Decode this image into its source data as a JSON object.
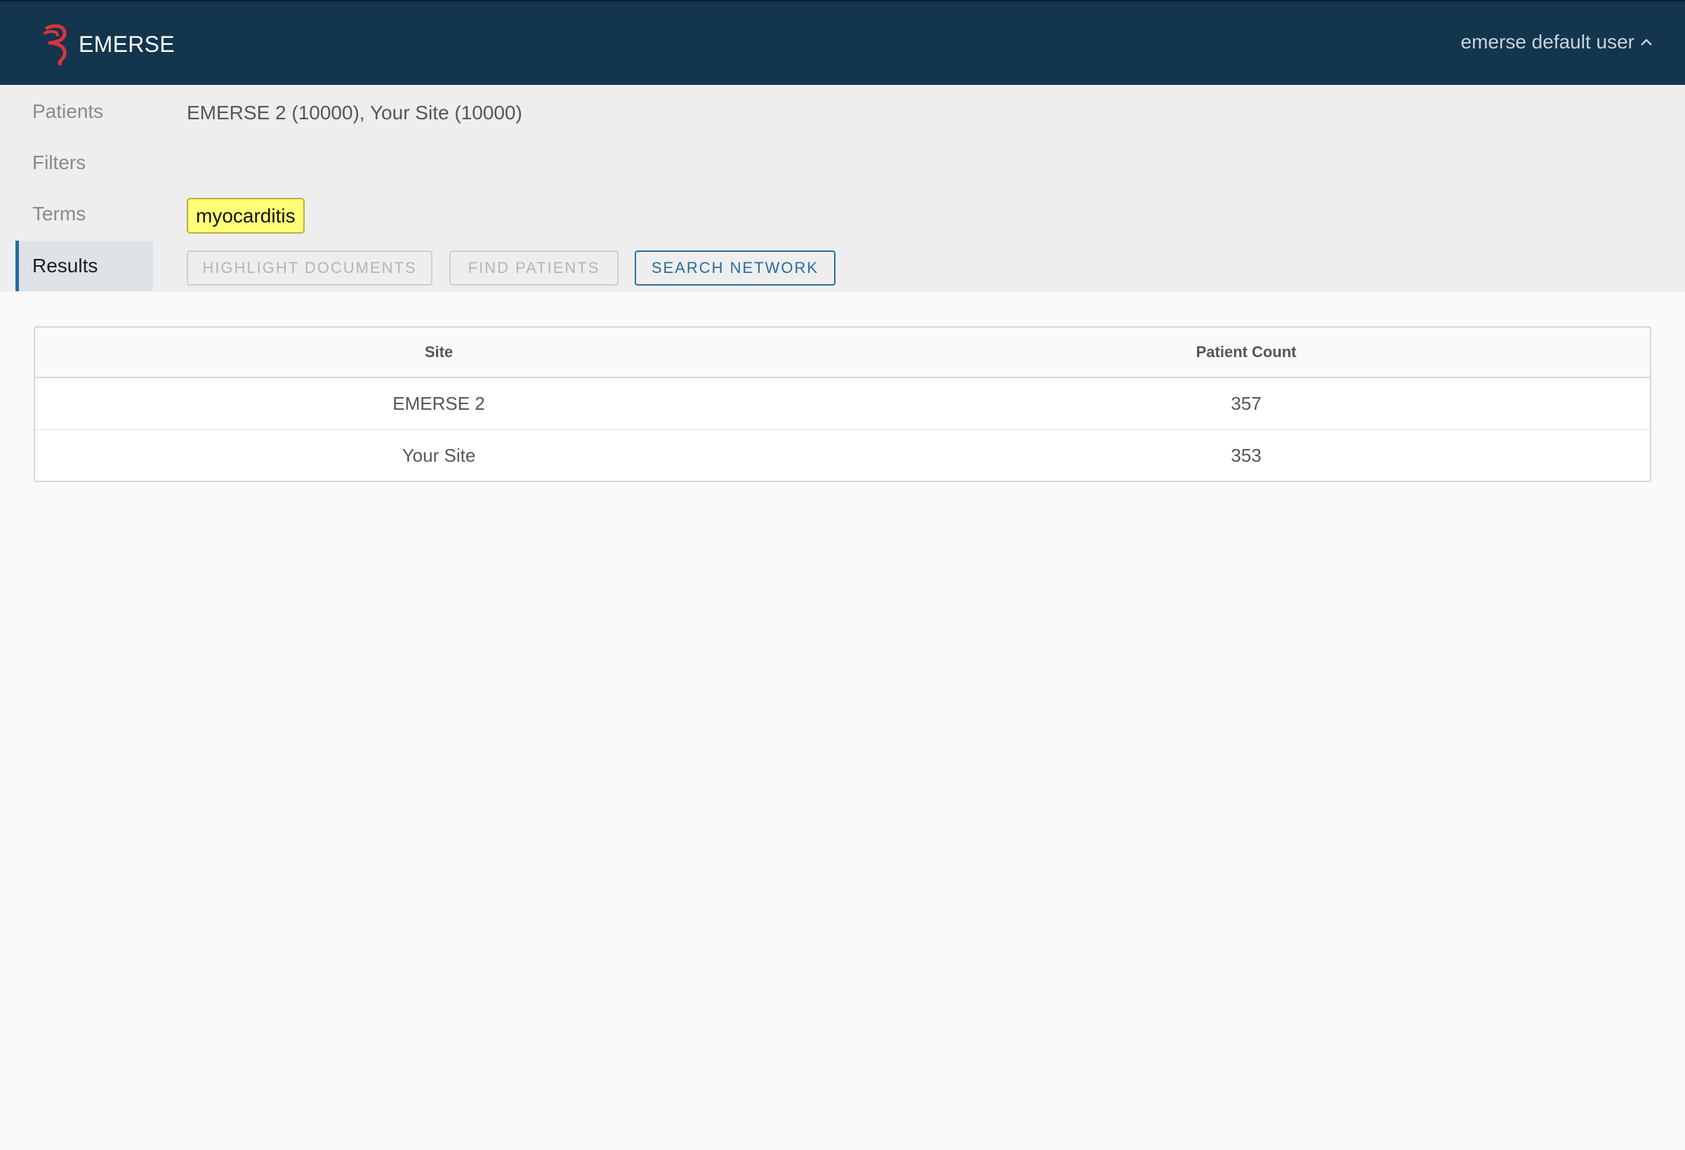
{
  "header": {
    "app_name": "EMERSE",
    "logo_icon": "emerse-logo-icon",
    "user_label": "emerse default user",
    "user_menu_icon": "chevron-up-icon",
    "colors": {
      "bar": "#13354d",
      "logo": "#d9353b"
    }
  },
  "sidebar": {
    "items": [
      {
        "label": "Patients",
        "active": false
      },
      {
        "label": "Filters",
        "active": false
      },
      {
        "label": "Terms",
        "active": false
      },
      {
        "label": "Results",
        "active": true
      }
    ]
  },
  "query": {
    "patients_summary": "EMERSE 2 (10000), Your Site (10000)",
    "terms": [
      "myocarditis"
    ]
  },
  "actions": {
    "highlight_documents": "HIGHLIGHT DOCUMENTS",
    "find_patients": "FIND PATIENTS",
    "search_network": "SEARCH NETWORK"
  },
  "results": {
    "columns": [
      "Site",
      "Patient Count"
    ],
    "rows": [
      [
        "EMERSE 2",
        "357"
      ],
      [
        "Your Site",
        "353"
      ]
    ]
  }
}
